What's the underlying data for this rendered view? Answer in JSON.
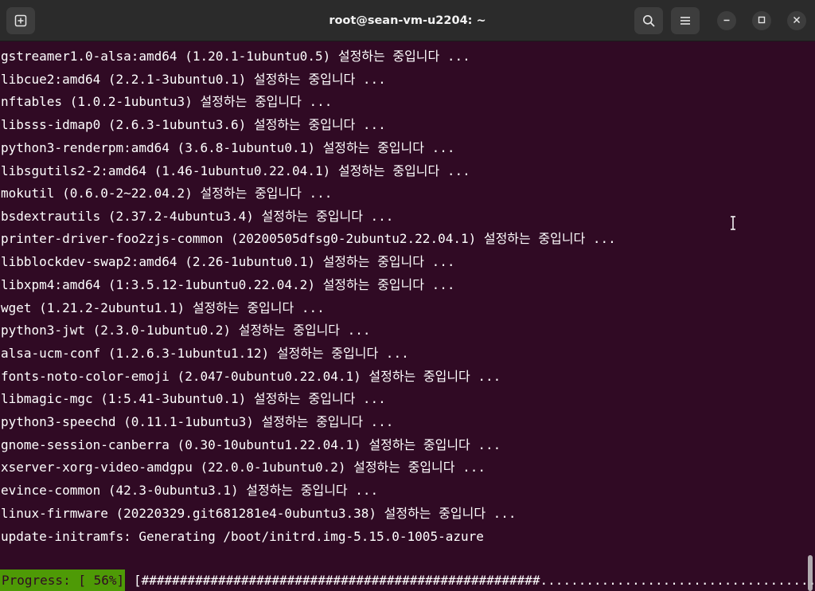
{
  "window": {
    "title": "root@sean-vm-u2204: ~"
  },
  "icons": {
    "new_tab": "new-tab-icon",
    "search": "search-icon",
    "menu": "hamburger-menu-icon",
    "minimize": "minimize-icon",
    "maximize": "maximize-icon",
    "close": "close-icon"
  },
  "colors": {
    "terminal_bg": "#300a24",
    "titlebar_bg": "#2b2b2b",
    "progress_bg": "#4e9a06",
    "text": "#ffffff"
  },
  "terminal": {
    "lines": [
      "gstreamer1.0-alsa:amd64 (1.20.1-1ubuntu0.5) 설정하는 중입니다 ...",
      "libcue2:amd64 (2.2.1-3ubuntu0.1) 설정하는 중입니다 ...",
      "nftables (1.0.2-1ubuntu3) 설정하는 중입니다 ...",
      "libsss-idmap0 (2.6.3-1ubuntu3.6) 설정하는 중입니다 ...",
      "python3-renderpm:amd64 (3.6.8-1ubuntu0.1) 설정하는 중입니다 ...",
      "libsgutils2-2:amd64 (1.46-1ubuntu0.22.04.1) 설정하는 중입니다 ...",
      "mokutil (0.6.0-2~22.04.2) 설정하는 중입니다 ...",
      "bsdextrautils (2.37.2-4ubuntu3.4) 설정하는 중입니다 ...",
      "printer-driver-foo2zjs-common (20200505dfsg0-2ubuntu2.22.04.1) 설정하는 중입니다 ...",
      "libblockdev-swap2:amd64 (2.26-1ubuntu0.1) 설정하는 중입니다 ...",
      "libxpm4:amd64 (1:3.5.12-1ubuntu0.22.04.2) 설정하는 중입니다 ...",
      "wget (1.21.2-2ubuntu1.1) 설정하는 중입니다 ...",
      "python3-jwt (2.3.0-1ubuntu0.2) 설정하는 중입니다 ...",
      "alsa-ucm-conf (1.2.6.3-1ubuntu1.12) 설정하는 중입니다 ...",
      "fonts-noto-color-emoji (2.047-0ubuntu0.22.04.1) 설정하는 중입니다 ...",
      "libmagic-mgc (1:5.41-3ubuntu0.1) 설정하는 중입니다 ...",
      "python3-speechd (0.11.1-1ubuntu3) 설정하는 중입니다 ...",
      "gnome-session-canberra (0.30-10ubuntu1.22.04.1) 설정하는 중입니다 ...",
      "xserver-xorg-video-amdgpu (22.0.0-1ubuntu0.2) 설정하는 중입니다 ...",
      "evince-common (42.3-0ubuntu3.1) 설정하는 중입니다 ...",
      "linux-firmware (20220329.git681281e4-0ubuntu3.38) 설정하는 중입니다 ...",
      "update-initramfs: Generating /boot/initrd.img-5.15.0-1005-azure"
    ],
    "progress_label": "Progress: [ 56%]",
    "progress_bar": "[####################################################.........................................]",
    "progress_percent": 56
  }
}
